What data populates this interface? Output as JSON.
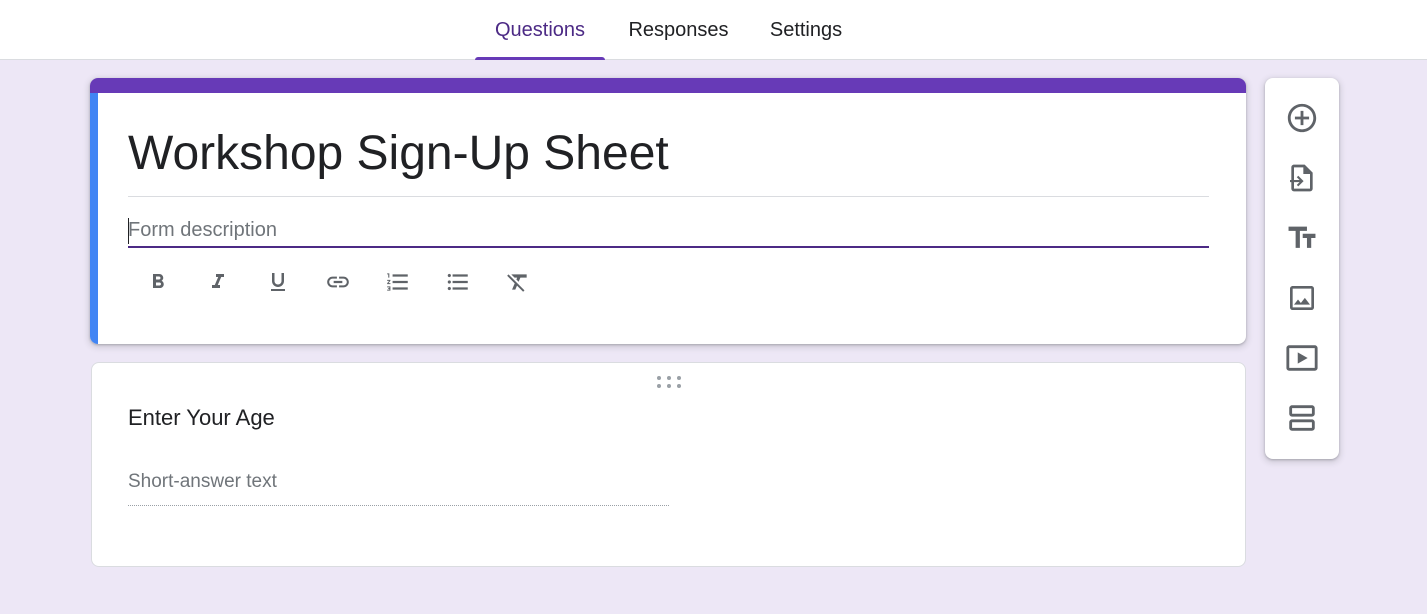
{
  "tabs": [
    {
      "label": "Questions",
      "active": true
    },
    {
      "label": "Responses",
      "active": false
    },
    {
      "label": "Settings",
      "active": false
    }
  ],
  "form": {
    "title": "Workshop Sign-Up Sheet",
    "description_placeholder": "Form description",
    "description_value": ""
  },
  "formatting_toolbar": [
    "bold-icon",
    "italic-icon",
    "underline-icon",
    "link-icon",
    "numbered-list-icon",
    "bulleted-list-icon",
    "clear-formatting-icon"
  ],
  "question": {
    "title": "Enter Your Age",
    "answer_placeholder": "Short-answer text"
  },
  "side_toolbar": [
    "add-question-icon",
    "import-questions-icon",
    "add-title-icon",
    "add-image-icon",
    "add-video-icon",
    "add-section-icon"
  ],
  "colors": {
    "accent": "#673ab7",
    "accent_dark": "#4c2a85",
    "active_card_strip": "#4285f4",
    "background": "#ede7f6",
    "icon": "#5f6368"
  }
}
